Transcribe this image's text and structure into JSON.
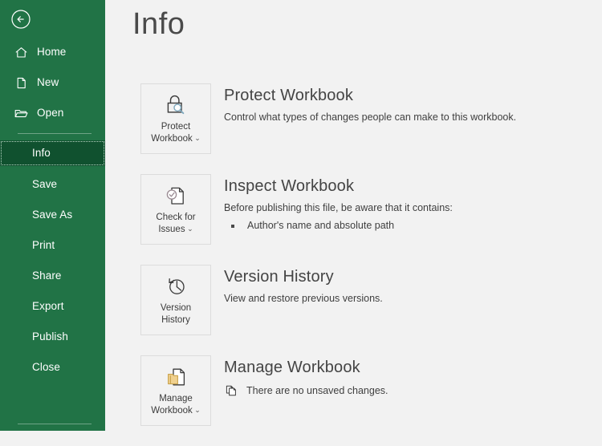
{
  "window": {
    "app": "Excel",
    "screen": "Backstage Info"
  },
  "sidebar": {
    "back_button": {
      "name": "Back",
      "icon": "back-arrow-circle-icon"
    },
    "items": [
      {
        "label": "Home",
        "icon": "home-icon",
        "active": false
      },
      {
        "label": "New",
        "icon": "new-document-icon",
        "active": false
      },
      {
        "label": "Open",
        "icon": "open-folder-icon",
        "active": false
      },
      {
        "label": "Info",
        "icon": "",
        "active": true
      },
      {
        "label": "Save",
        "icon": "",
        "active": false
      },
      {
        "label": "Save As",
        "icon": "",
        "active": false
      },
      {
        "label": "Print",
        "icon": "",
        "active": false
      },
      {
        "label": "Share",
        "icon": "",
        "active": false
      },
      {
        "label": "Export",
        "icon": "",
        "active": false
      },
      {
        "label": "Publish",
        "icon": "",
        "active": false
      },
      {
        "label": "Close",
        "icon": "",
        "active": false
      }
    ],
    "background_color": "#217346",
    "active_item_color": "#10512f"
  },
  "main": {
    "title": "Info",
    "sections": {
      "protect": {
        "tile_label_line1": "Protect",
        "tile_label_line2": "Workbook",
        "tile_has_chevron": true,
        "tile_icon": "lock-magnifier-icon",
        "heading": "Protect Workbook",
        "description": "Control what types of changes people can make to this workbook."
      },
      "inspect": {
        "tile_label_line1": "Check for",
        "tile_label_line2": "Issues",
        "tile_has_chevron": true,
        "tile_icon": "document-check-icon",
        "heading": "Inspect Workbook",
        "description": "Before publishing this file, be aware that it contains:",
        "bullets": [
          "Author's name and absolute path"
        ]
      },
      "version": {
        "tile_label_line1": "Version",
        "tile_label_line2": "History",
        "tile_has_chevron": false,
        "tile_icon": "clock-history-icon",
        "heading": "Version History",
        "description": "View and restore previous versions."
      },
      "manage": {
        "tile_label_line1": "Manage",
        "tile_label_line2": "Workbook",
        "tile_has_chevron": true,
        "tile_icon": "document-folder-icon",
        "heading": "Manage Workbook",
        "status_icon": "copy-pages-icon",
        "status_text": "There are no unsaved changes."
      }
    }
  },
  "colors": {
    "brand_green": "#217346",
    "active_green": "#10512f",
    "content_bg": "#f2f2f2",
    "tile_border": "#dcdcdc",
    "heading_text": "#444444",
    "body_text": "#3f3f3f",
    "icon_stroke": "#3a3a3a",
    "folder_yellow": "#e8c36a"
  }
}
